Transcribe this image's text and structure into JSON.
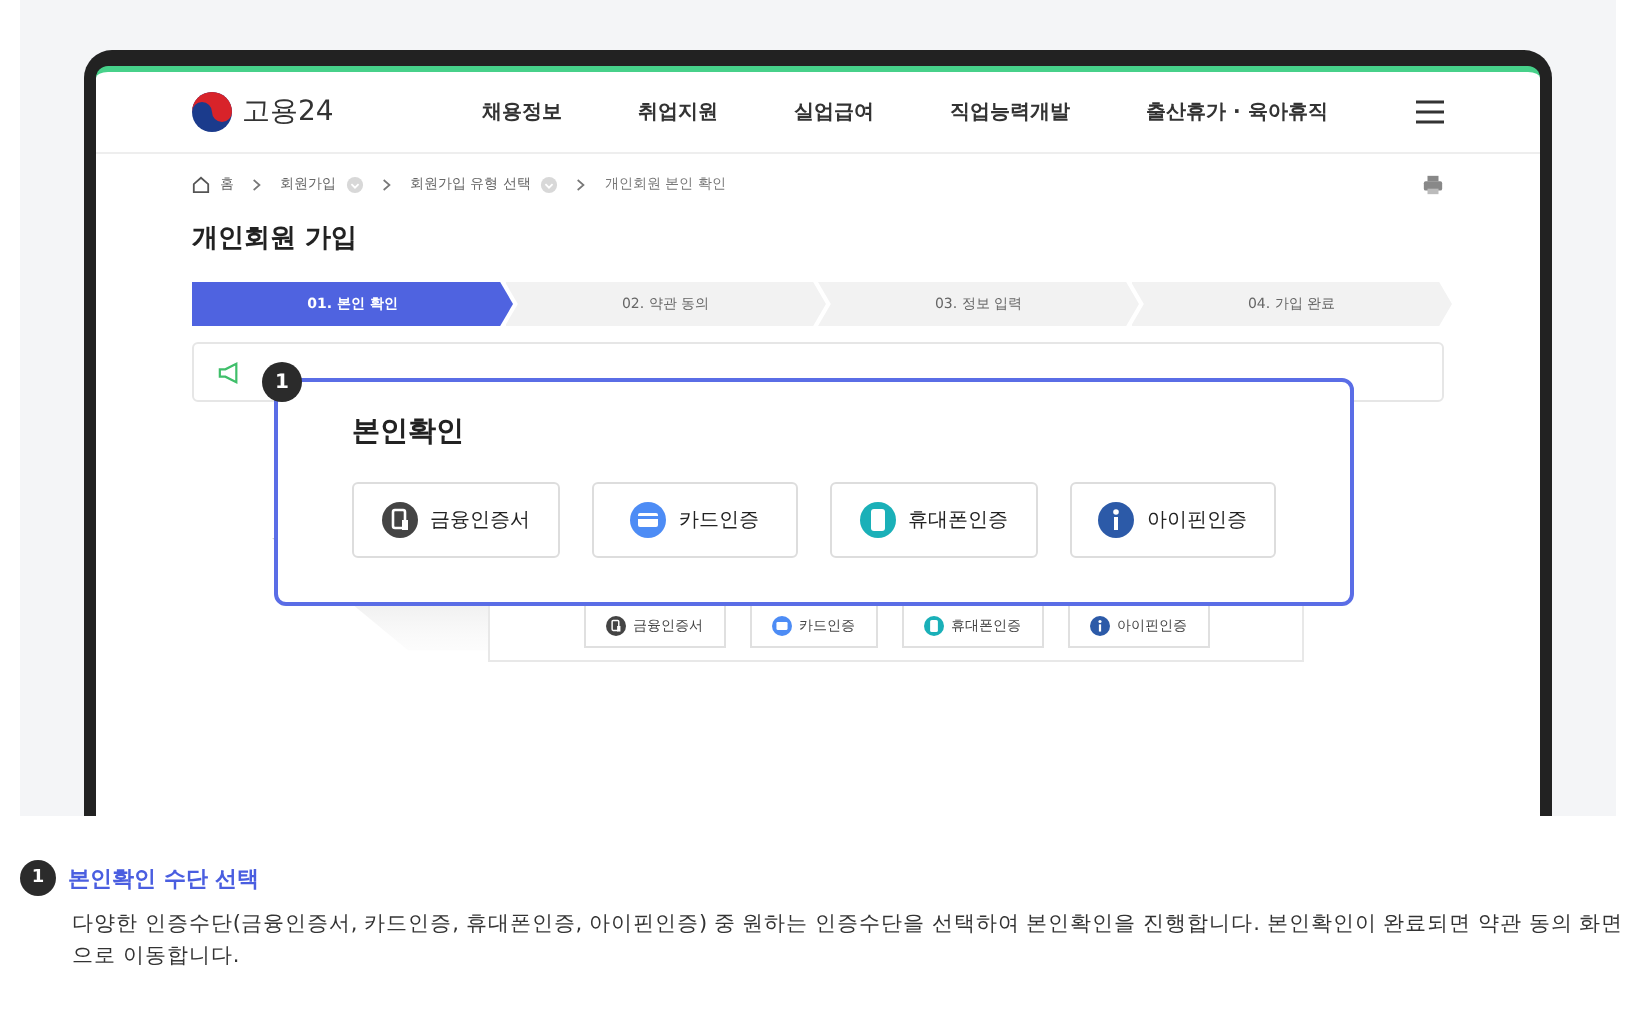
{
  "header": {
    "logo": "고용24",
    "nav": [
      "채용정보",
      "취업지원",
      "실업급여",
      "직업능력개발",
      "출산휴가 · 육아휴직"
    ]
  },
  "breadcrumb": [
    {
      "label": "홈",
      "kind": "home"
    },
    {
      "label": "회원가입",
      "kind": "link"
    },
    {
      "label": "회원가입 유형 선택",
      "kind": "link"
    },
    {
      "label": "개인회원 본인 확인",
      "kind": "current"
    }
  ],
  "page_title": "개인회원 가입",
  "steps": [
    {
      "label": "01. 본인 확인",
      "selected": true
    },
    {
      "label": "02. 약관 동의",
      "selected": false
    },
    {
      "label": "03. 정보 입력",
      "selected": false
    },
    {
      "label": "04. 가입 완료",
      "selected": false
    }
  ],
  "callout": {
    "number": "1",
    "title": "본인확인",
    "methods": [
      {
        "label": "금융인증서",
        "kind": "certificate"
      },
      {
        "label": "카드인증",
        "kind": "card"
      },
      {
        "label": "휴대폰인증",
        "kind": "phone"
      },
      {
        "label": "아이핀인증",
        "kind": "ipin"
      }
    ]
  },
  "background_methods": [
    {
      "label": "금융인증서",
      "kind": "certificate"
    },
    {
      "label": "카드인증",
      "kind": "card"
    },
    {
      "label": "휴대폰인증",
      "kind": "phone"
    },
    {
      "label": "아이핀인증",
      "kind": "ipin"
    }
  ],
  "description": {
    "number": "1",
    "title": "본인확인 수단 선택",
    "text": "다양한 인증수단(금융인증서, 카드인증, 휴대폰인증, 아이핀인증) 중 원하는 인증수단을 선택하여 본인확인을 진행합니다. 본인확인이 완료되면 약관 동의 화면으로 이동합니다."
  }
}
